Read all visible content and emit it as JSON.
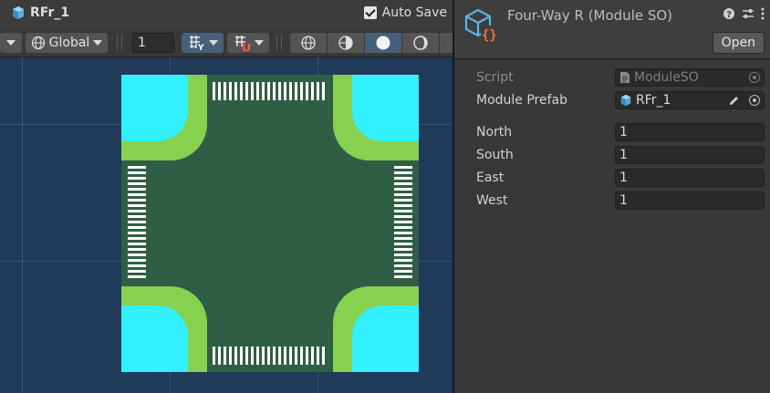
{
  "scene": {
    "tab_title": "RFr_1",
    "autosave_label": "Auto Save",
    "autosave_checked": true,
    "toolbar": {
      "pivot_mode": "Global",
      "grid_size": "1"
    }
  },
  "inspector": {
    "title": "Four-Way R (Module SO)",
    "open_button": "Open",
    "fields": {
      "script_label": "Script",
      "script_value": "ModuleSO",
      "prefab_label": "Module Prefab",
      "prefab_value": "RFr_1",
      "north_label": "North",
      "north_value": "1",
      "south_label": "South",
      "south_value": "1",
      "east_label": "East",
      "east_value": "1",
      "west_label": "West",
      "west_value": "1"
    }
  },
  "colors": {
    "scene_background": "#203a5a",
    "corner_cyan": "#33f0ff",
    "curb_green": "#86d14e",
    "road_green": "#305e45",
    "crosswalk_white": "#ffffff",
    "script_icon_orange": "#ff6a3d"
  }
}
